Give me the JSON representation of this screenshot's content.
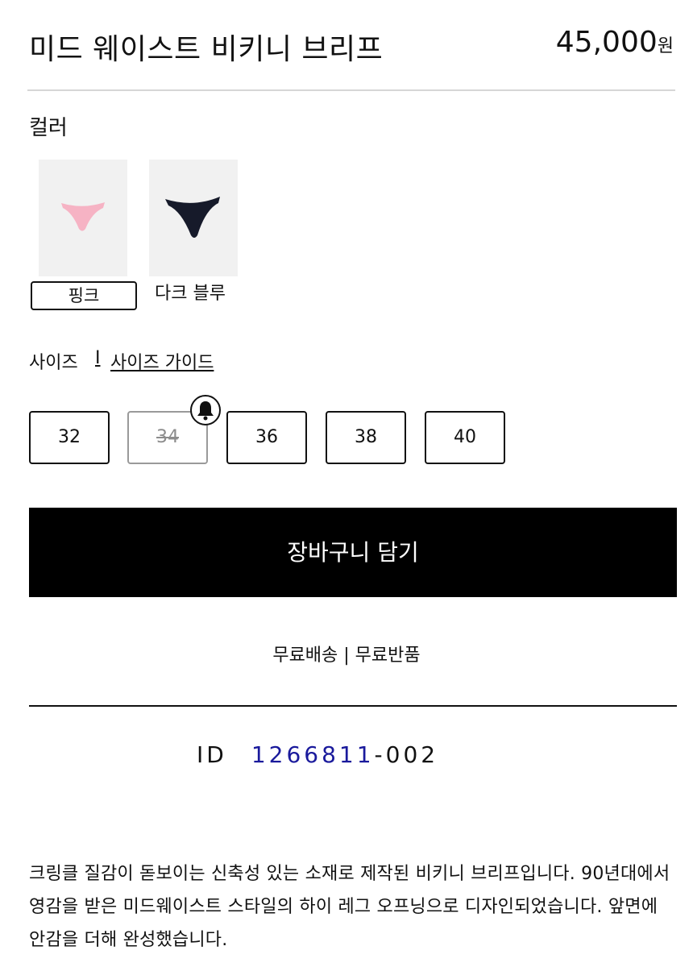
{
  "product": {
    "title": "미드 웨이스트 비키니 브리프",
    "price": "45,000",
    "currency": "원"
  },
  "color": {
    "label": "컬러",
    "options": [
      {
        "name": "핑크",
        "swatch_color": "#f6b3c4",
        "selected": true
      },
      {
        "name": "다크 블루",
        "swatch_color": "#161a2a",
        "selected": false
      }
    ]
  },
  "size": {
    "label": "사이즈",
    "separator": "I",
    "guide_link": "사이즈 가이드",
    "options": [
      {
        "value": "32",
        "available": true
      },
      {
        "value": "34",
        "available": false
      },
      {
        "value": "36",
        "available": true
      },
      {
        "value": "38",
        "available": true
      },
      {
        "value": "40",
        "available": true
      }
    ]
  },
  "cart": {
    "button_label": "장바구니 담기"
  },
  "shipping_info": "무료배송 | 무료반품",
  "product_id": {
    "label": "ID",
    "main": "1266811",
    "suffix": "-002"
  },
  "description": "크링클 질감이 돋보이는 신축성 있는 소재로 제작된 비키니 브리프입니다. 90년대에서 영감을 받은 미드웨이스트 스타일의 하이 레그 오프닝으로 디자인되었습니다. 앞면에 안감을 더해 완성했습니다.",
  "colors": {
    "accent_id": "#1a1a9c",
    "button_bg": "#000000",
    "disabled": "#8c8c8c"
  }
}
